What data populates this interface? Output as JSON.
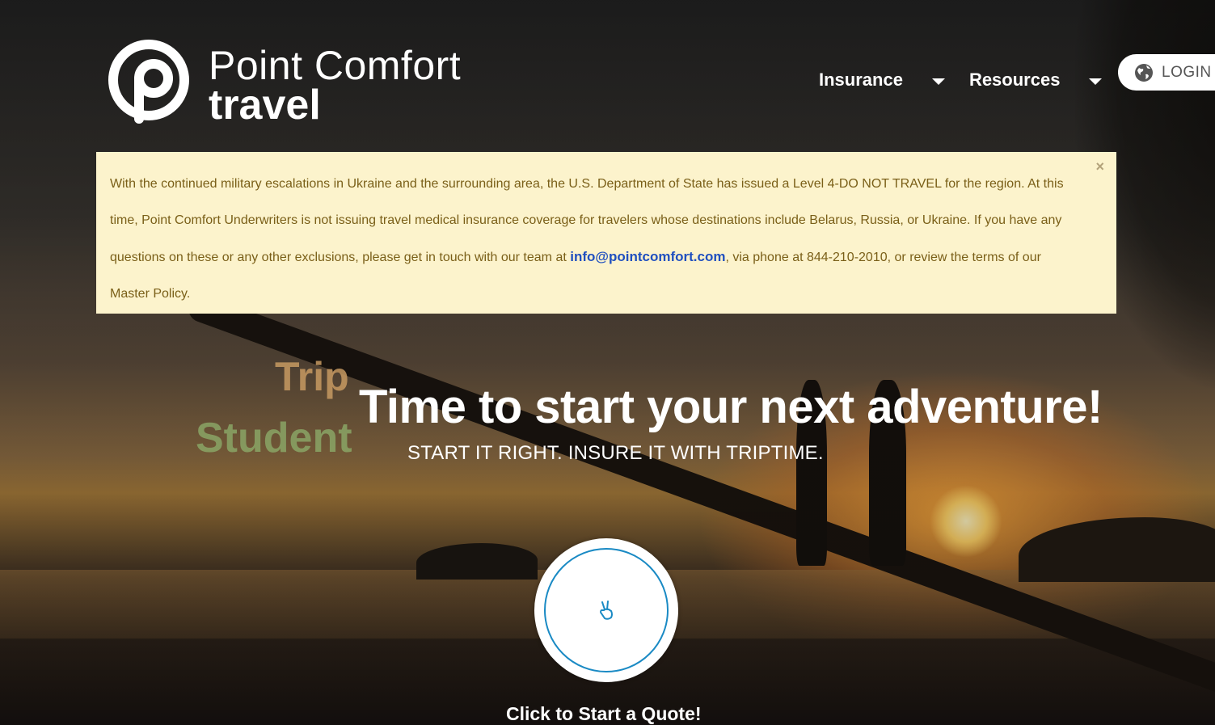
{
  "brand": {
    "name_line1": "Point Comfort",
    "name_line2": "travel",
    "logo_icon": "point-comfort-p-logo"
  },
  "nav": {
    "items": [
      {
        "label": "Insurance",
        "icon": "caret-down"
      },
      {
        "label": "Resources",
        "icon": "caret-down"
      }
    ],
    "login_label": "LOGIN",
    "login_icon": "globe"
  },
  "alert": {
    "text_before_link": "With the continued military escalations in Ukraine and the surrounding area, the U.S. Department of State has issued a Level 4-DO NOT TRAVEL for the region.  At this time, Point Comfort Underwriters is not issuing travel medical insurance coverage for travelers whose destinations include Belarus, Russia, or Ukraine. If you have any questions on these or any other exclusions, please get in touch with our team at ",
    "link_text": "info@pointcomfort.com",
    "text_after_link": ", via phone at 844-210-2010, or review the terms of our Master Policy.",
    "close_label": "×"
  },
  "hero": {
    "rotating_words": [
      "Trip",
      "Student"
    ],
    "title": "Time to start your next adventure!",
    "subtitle": "START IT RIGHT. INSURE IT WITH TRIPTIME.",
    "cta_label": "Click to Start a Quote!",
    "cta_icon": "peace-hand"
  },
  "colors": {
    "alert_bg": "#fcf3cc",
    "alert_text": "#7a5f18",
    "link": "#1f4fbf",
    "cta_ring": "#1a8ac4",
    "trip_word": "#c79a62",
    "student_word": "#8aa566"
  }
}
